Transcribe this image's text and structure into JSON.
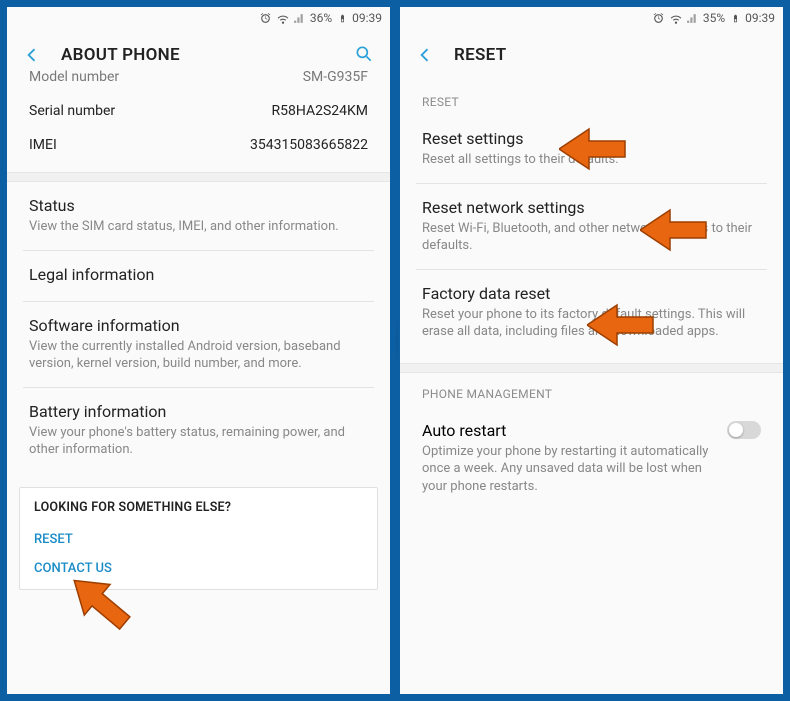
{
  "left": {
    "status": {
      "battery": "36%",
      "time": "09:39"
    },
    "header": {
      "title": "ABOUT PHONE"
    },
    "rows": {
      "model": {
        "k": "Model number",
        "v": "SM-G935F"
      },
      "serial": {
        "k": "Serial number",
        "v": "R58HA2S24KM"
      },
      "imei": {
        "k": "IMEI",
        "v": "354315083665822"
      }
    },
    "items": {
      "status": {
        "t": "Status",
        "d": "View the SIM card status, IMEI, and other information."
      },
      "legal": {
        "t": "Legal information"
      },
      "software": {
        "t": "Software information",
        "d": "View the currently installed Android version, baseband version, kernel version, build number, and more."
      },
      "battery": {
        "t": "Battery information",
        "d": "View your phone's battery status, remaining power, and other information."
      }
    },
    "looking": {
      "h": "LOOKING FOR SOMETHING ELSE?",
      "reset": "RESET",
      "contact": "CONTACT US"
    }
  },
  "right": {
    "status": {
      "battery": "35%",
      "time": "09:39"
    },
    "header": {
      "title": "RESET"
    },
    "sections": {
      "reset": "RESET",
      "phone": "PHONE MANAGEMENT"
    },
    "items": {
      "rs": {
        "t": "Reset settings",
        "d": "Reset all settings to their defaults."
      },
      "rn": {
        "t": "Reset network settings",
        "d": "Reset Wi-Fi, Bluetooth, and other network settings to their defaults."
      },
      "fd": {
        "t": "Factory data reset",
        "d": "Reset your phone to its factory default settings. This will erase all data, including files and downloaded apps."
      },
      "ar": {
        "t": "Auto restart",
        "d": "Optimize your phone by restarting it automatically once a week. Any unsaved data will be lost when your phone restarts."
      }
    }
  }
}
